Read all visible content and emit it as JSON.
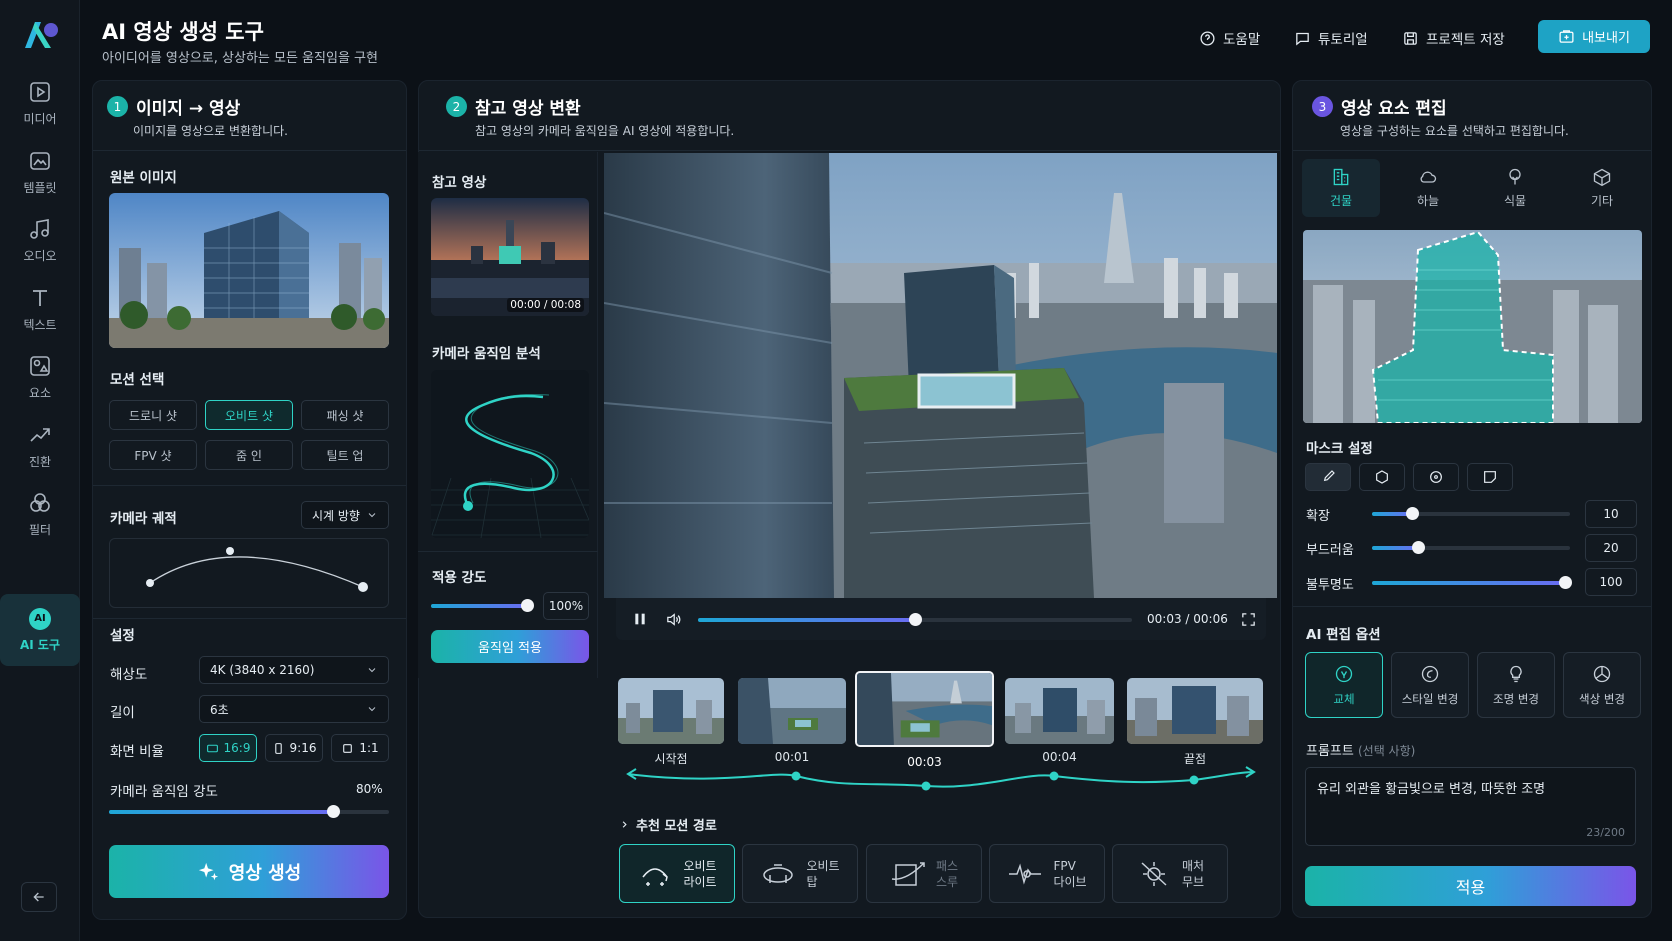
{
  "header": {
    "title": "AI 영상 생성 도구",
    "subtitle": "아이디어를 영상으로, 상상하는 모든 움직임을 구현",
    "help": "도움말",
    "tutorial": "튜토리얼",
    "save": "프로젝트 저장",
    "export": "내보내기"
  },
  "sidebar": {
    "items": [
      {
        "label": "미디어",
        "icon": "media-icon"
      },
      {
        "label": "템플릿",
        "icon": "template-icon"
      },
      {
        "label": "오디오",
        "icon": "audio-icon"
      },
      {
        "label": "텍스트",
        "icon": "text-icon"
      },
      {
        "label": "요소",
        "icon": "element-icon"
      },
      {
        "label": "진환",
        "icon": "transition-icon"
      },
      {
        "label": "필터",
        "icon": "filter-icon"
      },
      {
        "label": "AI 도구",
        "icon": "ai-icon",
        "badge": "AI"
      }
    ]
  },
  "panel1": {
    "num": "1",
    "title": "이미지 → 영상",
    "desc": "이미지를 영상으로 변환합니다.",
    "source_label": "원본 이미지",
    "motion_label": "모션 선택",
    "motions": [
      "드로니 샷",
      "오비트 샷",
      "패싱 샷",
      "FPV 샷",
      "줌 인",
      "틸트 업"
    ],
    "selected_motion": "오비트 샷",
    "trajectory_label": "카메라 궤적",
    "trajectory_dir": "시계 방향",
    "settings_label": "설정",
    "resolution_label": "해상도",
    "resolution": "4K (3840 x 2160)",
    "length_label": "길이",
    "length": "6초",
    "ratio_label": "화면 비율",
    "ratios": [
      "16:9",
      "9:16",
      "1:1"
    ],
    "selected_ratio": "16:9",
    "intensity_label": "카메라 움직임 강도",
    "intensity": "80%",
    "intensity_value": 0.8,
    "generate": "영상 생성"
  },
  "panel2": {
    "num": "2",
    "title": "참고 영상 변환",
    "desc": "참고 영상의 카메라 움직임을 AI 영상에 적용합니다.",
    "ref_label": "참고 영상",
    "ref_time": "00:00 / 00:08",
    "analysis_label": "카메라 움직임 분석",
    "strength_label": "적용 강도",
    "strength": "100%",
    "strength_value": 1.0,
    "apply": "움직임 적용"
  },
  "player": {
    "time": "00:03 / 00:06",
    "progress": 0.5,
    "frames": [
      "시작점",
      "00:01",
      "00:03",
      "00:04",
      "끝점"
    ],
    "selected_frame": "00:03",
    "recommend_label": "추천 모션 경로",
    "motion_cards": [
      {
        "line1": "오비트",
        "line2": "라이트"
      },
      {
        "line1": "오비트",
        "line2": "탑"
      },
      {
        "line1": "패스",
        "line2": "스루"
      },
      {
        "line1": "FPV",
        "line2": "다이브"
      },
      {
        "line1": "매처",
        "line2": "무브"
      }
    ]
  },
  "panel3": {
    "num": "3",
    "title": "영상 요소 편집",
    "desc": "영상을 구성하는 요소를 선택하고 편집합니다.",
    "tabs": [
      "건물",
      "하늘",
      "식물",
      "기타"
    ],
    "selected_tab": "건물",
    "mask_label": "마스크 설정",
    "expand_label": "확장",
    "expand": "10",
    "expand_value": 0.2,
    "soft_label": "부드러움",
    "soft": "20",
    "soft_value": 0.23,
    "opacity_label": "불투명도",
    "opacity": "100",
    "opacity_value": 1.0,
    "ai_label": "AI 편집 옵션",
    "ai_options": [
      "교체",
      "스타일 변경",
      "조명 변경",
      "색상 변경"
    ],
    "selected_ai": "교체",
    "prompt_label": "프롬프트",
    "prompt_optional": "(선택 사항)",
    "prompt_text": "유리 외관을 황금빛으로 변경, 따뜻한 조명",
    "prompt_count": "23/200",
    "apply": "적용"
  },
  "colors": {
    "accent": "#2fd3c6",
    "bg": "#0c1117",
    "panel": "#121920"
  }
}
